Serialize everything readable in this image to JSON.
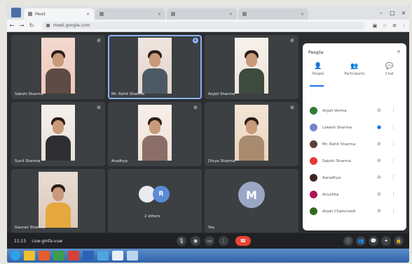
{
  "browser": {
    "tabs": [
      {
        "label": "Meet",
        "active": true
      },
      {
        "label": "",
        "active": false
      },
      {
        "label": "",
        "active": false
      },
      {
        "label": "",
        "active": false
      }
    ],
    "url": "meet.google.com"
  },
  "tiles": [
    {
      "name": "Sakshi Sharma"
    },
    {
      "name": "Mr. Rohit Sharma"
    },
    {
      "name": "Anjali Sharma"
    },
    {
      "name": "Sunil Sharma"
    },
    {
      "name": "Aradhya"
    },
    {
      "name": "Divya Sharma"
    },
    {
      "name": "Gaurav Sharma"
    },
    {
      "name": "2 others",
      "initial": "R"
    },
    {
      "name": "You",
      "initial": "M"
    }
  ],
  "bottombar": {
    "time": "11:15",
    "code": "cuw-gmfa-vuw"
  },
  "people": {
    "title": "People",
    "tabs": [
      {
        "label": "People"
      },
      {
        "label": "Participants"
      },
      {
        "label": "Chat"
      }
    ],
    "rows": [
      {
        "name": "Anjali Verma",
        "color": "#2e7d32"
      },
      {
        "name": "Lokesh Sharma",
        "color": "#7986cb"
      },
      {
        "name": "Mr. Rohit Sharma",
        "color": "#5d4037"
      },
      {
        "name": "Sakshi Sharma",
        "color": "#e53935"
      },
      {
        "name": "Aaradhya",
        "color": "#3e2723"
      },
      {
        "name": "Anushka",
        "color": "#ad1457"
      },
      {
        "name": "Anjali Chaturvedi",
        "color": "#33691e"
      }
    ]
  },
  "colors": {
    "accent": "#1a73e8",
    "end_call": "#ea4335",
    "tile_bg": "#3c4043"
  }
}
